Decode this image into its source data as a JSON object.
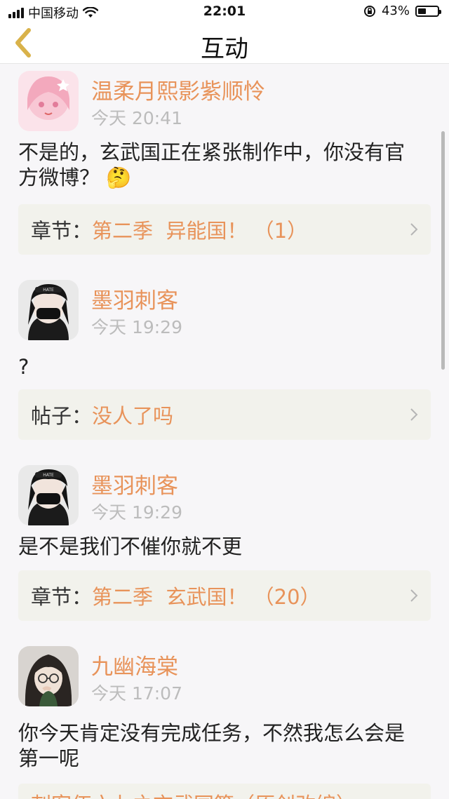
{
  "status_bar": {
    "carrier": "中国移动",
    "time": "22:01",
    "battery_percent": "43%",
    "battery_level": 0.43
  },
  "nav": {
    "title": "互动"
  },
  "feed": [
    {
      "user": "温柔月熙影紫顺怜",
      "time": "今天 20:41",
      "text": "不是的，玄武国正在紧张制作中，你没有官方微博？ 🤔",
      "ref_prefix": "章节：",
      "ref_target": "第二季  异能国！ （1）"
    },
    {
      "user": "墨羽刺客",
      "time": "今天 19:29",
      "text": "?",
      "ref_prefix": "帖子：",
      "ref_target": "没人了吗"
    },
    {
      "user": "墨羽刺客",
      "time": "今天 19:29",
      "text": "是不是我们不催你就不更",
      "ref_prefix": "章节：",
      "ref_target": "第二季  玄武国！ （20）"
    },
    {
      "user": "九幽海棠",
      "time": "今天 17:07",
      "text": "你今天肯定没有完成任务，不然我怎么会是第一呢",
      "ref_cut": "刺客伍六七之玄武国篇（原创改编）"
    }
  ],
  "icons": {
    "back": "chevron-left-icon",
    "chevron": "chevron-right-icon"
  },
  "colors": {
    "accent": "#e8935a",
    "back_arrow": "#d9b24a"
  }
}
